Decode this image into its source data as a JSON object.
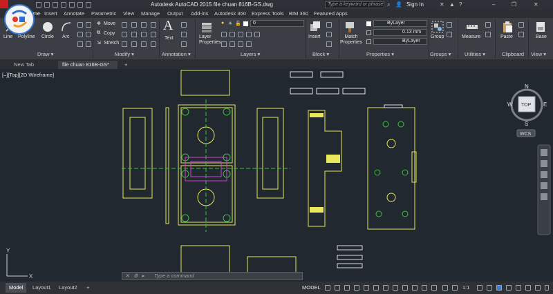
{
  "app": {
    "title": "Autodesk AutoCAD 2015   file chuan 816B-GS.dwg",
    "search_placeholder": "Type a keyword or phrase",
    "sign_in": "Sign In",
    "help": "?",
    "window_controls": [
      "–",
      "❐",
      "✕"
    ]
  },
  "ribbon_tabs": [
    "Home",
    "Insert",
    "Annotate",
    "Parametric",
    "View",
    "Manage",
    "Output",
    "Add-ins",
    "Autodesk 360",
    "Express Tools",
    "BIM 360",
    "Featured Apps"
  ],
  "ribbon": {
    "draw": {
      "label": "Draw ▾",
      "tools": [
        "Line",
        "Polyline",
        "Circle",
        "Arc"
      ]
    },
    "modify": {
      "label": "Modify ▾",
      "move": "Move",
      "copy": "Copy",
      "stretch": "Stretch"
    },
    "annotation": {
      "label": "Annotation ▾",
      "text": "Text"
    },
    "layers": {
      "label": "Layers ▾",
      "layer_properties": "Layer Properties",
      "current_layer": "0"
    },
    "block": {
      "label": "Block ▾",
      "insert": "Insert"
    },
    "properties": {
      "label": "Properties ▾",
      "match": "Match Properties",
      "color": "ByLayer",
      "lineweight": "0.13 mm",
      "linetype": "ByLayer"
    },
    "groups": {
      "label": "Groups ▾",
      "group": "Group"
    },
    "utilities": {
      "label": "Utilities ▾",
      "measure": "Measure"
    },
    "clipboard": {
      "label": "Clipboard",
      "paste": "Paste"
    },
    "view": {
      "label": "View ▾",
      "base": "Base"
    }
  },
  "doc_tabs": [
    "New Tab",
    "file chuan 816B-GS*",
    "+"
  ],
  "viewport": {
    "label": "[–][Top][2D Wireframe]",
    "viewcube": {
      "top": "TOP",
      "n": "N",
      "s": "S",
      "e": "E",
      "w": "W",
      "wcs": "WCS"
    },
    "ucs": {
      "x": "X",
      "y": "Y"
    }
  },
  "command_line": {
    "placeholder": "Type a command"
  },
  "layout_tabs": [
    "Model",
    "Layout1",
    "Layout2"
  ],
  "status": {
    "model": "MODEL",
    "scale": "1:1"
  },
  "colors": {
    "accent": "#3a7bd5",
    "drawing_yellow": "#e8e85a",
    "drawing_green": "#3fbf3f",
    "drawing_magenta": "#d044d0",
    "canvas": "#212830"
  }
}
